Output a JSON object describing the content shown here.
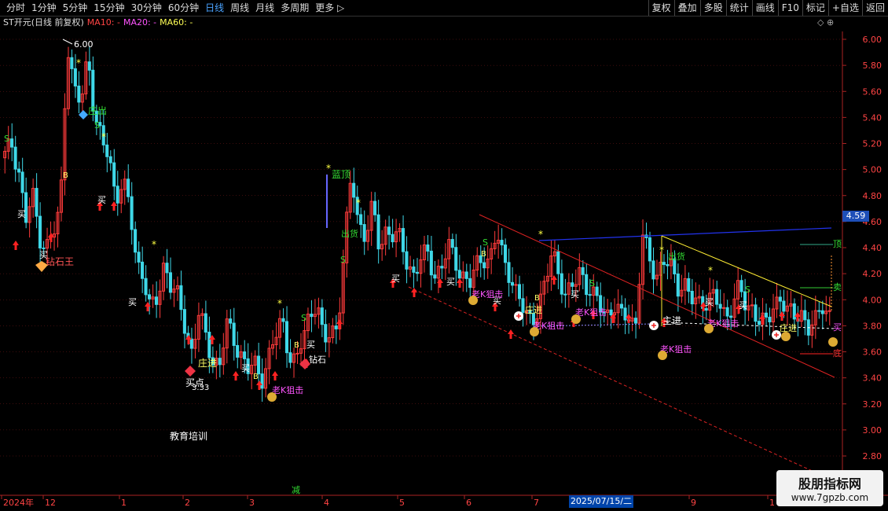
{
  "toolbar": {
    "periods": [
      "分时",
      "1分钟",
      "5分钟",
      "15分钟",
      "30分钟",
      "60分钟",
      "日线",
      "周线",
      "月线",
      "多周期",
      "更多 ▷"
    ],
    "active_period": "日线",
    "actions": [
      "复权",
      "叠加",
      "多股",
      "统计",
      "画线",
      "F10",
      "标记",
      "+自选",
      "返回"
    ]
  },
  "info": {
    "title": "ST开元(日线 前复权)",
    "ma10": "MA10: -",
    "ma20": "MA20: -",
    "ma60": "MA60: -",
    "icons": "◇ ⊕"
  },
  "colors": {
    "up": "#ff3b3b",
    "down": "#3fd8e8",
    "background": "#000000",
    "grid": "#7a1a1a",
    "buy": "#ff2222",
    "label_green": "#33dd33",
    "label_magenta": "#ff55ff",
    "trend_red": "#dd2222",
    "trend_blue": "#2233ee",
    "trend_yellow": "#ffee33"
  },
  "chart_data": {
    "type": "candlestick",
    "title": "ST开元(日线 前复权)",
    "ylim": [
      2.7,
      6.1
    ],
    "y_ticks": [
      "6.00",
      "5.80",
      "5.60",
      "5.40",
      "5.20",
      "5.00",
      "4.80",
      "4.60",
      "4.40",
      "4.20",
      "4.00",
      "3.80",
      "3.60",
      "3.40",
      "3.20",
      "3.00",
      "2.80"
    ],
    "x_ticks": [
      "2024年",
      "12",
      "1",
      "2",
      "3",
      "4",
      "5",
      "6",
      "7",
      "2025/07/15/二",
      "9",
      "1"
    ],
    "last_price": "4.59",
    "max_label": "6.00",
    "min_label": "3.33",
    "trend_points": [
      [
        5.1,
        5.2,
        5.0,
        4.6,
        4.8,
        4.5,
        4.4,
        4.5,
        4.7,
        6.0,
        5.6,
        5.5,
        5.9,
        5.4,
        5.2,
        5.1,
        4.8,
        4.9,
        4.7,
        4.3
      ],
      [
        4.2,
        3.9,
        4.0,
        4.3,
        4.1,
        4.0,
        3.8,
        3.6,
        3.9,
        3.7,
        3.55,
        3.5,
        3.8,
        3.7,
        3.6,
        3.45,
        3.5,
        3.4,
        3.55,
        3.7
      ],
      [
        3.85,
        3.6,
        3.5,
        3.7,
        3.9,
        4.0,
        3.65,
        3.75,
        3.8,
        4.4,
        4.95,
        4.6,
        4.5,
        4.7,
        4.4,
        4.55,
        4.5,
        4.45,
        4.3,
        4.2
      ],
      [
        4.3,
        4.35,
        4.2,
        4.25,
        4.4,
        4.3,
        4.2,
        4.1,
        4.25,
        4.35,
        4.3,
        4.5,
        4.3,
        4.2,
        4.0,
        3.9,
        3.85,
        3.95,
        4.1,
        4.4
      ],
      [
        4.2,
        4.0,
        4.1,
        4.25,
        4.1,
        4.0,
        3.95,
        3.9,
        3.95,
        3.85,
        3.9,
        3.8,
        4.48,
        4.3,
        4.2,
        4.3,
        4.25,
        4.1,
        4.15,
        4.0
      ],
      [
        3.95,
        4.0,
        4.05,
        3.95,
        3.85,
        4.0,
        4.1,
        3.9,
        3.95,
        3.85,
        3.8,
        3.95,
        4.05,
        3.9,
        3.85,
        3.9,
        3.8,
        3.82,
        3.95,
        3.9
      ]
    ],
    "annotations": [
      {
        "text": "6.00",
        "color": "#ffffff",
        "kind": "max"
      },
      {
        "text": "庄出",
        "color": "#33dd33"
      },
      {
        "text": "S",
        "color": "#33dd33"
      },
      {
        "text": "买",
        "color": "#ffffff"
      },
      {
        "text": "钻石王",
        "color": "#ff5555"
      },
      {
        "text": "蓝顶",
        "color": "#33dd33"
      },
      {
        "text": "出货",
        "color": "#33dd33"
      },
      {
        "text": "庄进",
        "color": "#ffff66"
      },
      {
        "text": "买点",
        "color": "#ffffff"
      },
      {
        "text": "3.33",
        "color": "#ffffff",
        "kind": "min"
      },
      {
        "text": "老K狙击",
        "color": "#ff55ff"
      },
      {
        "text": "钻石",
        "color": "#ffffff"
      },
      {
        "text": "B",
        "color": "#ffff66"
      },
      {
        "text": "主进",
        "color": "#ffffff"
      },
      {
        "text": "教育培训",
        "color": "#ffffff"
      },
      {
        "text": "顶",
        "color": "#33dd33"
      },
      {
        "text": "卖",
        "color": "#33dd33"
      },
      {
        "text": "买",
        "color": "#ff55ff"
      },
      {
        "text": "底",
        "color": "#ff3333"
      },
      {
        "text": "减",
        "color": "#33dd33"
      }
    ]
  },
  "watermark": {
    "line1": "股朋指标网",
    "line2": "www.7gpzb.com"
  }
}
